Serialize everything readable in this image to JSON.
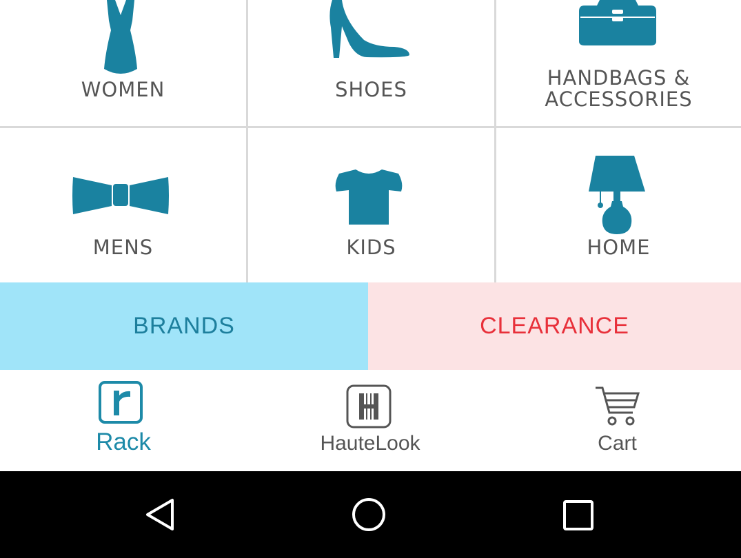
{
  "colors": {
    "teal": "#1a82a0",
    "category_text": "#555555",
    "brands_bg": "#a0e4f9",
    "brands_text": "#1d7f9d",
    "clearance_bg": "#fce3e4",
    "clearance_text": "#e8303a",
    "nav_active": "#1d8aa8",
    "nav_inactive": "#555555"
  },
  "categories": [
    {
      "label": "WOMEN",
      "icon": "dress-icon"
    },
    {
      "label": "SHOES",
      "icon": "high-heel-icon"
    },
    {
      "label_line1": "HANDBAGS &",
      "label_line2": "ACCESSORIES",
      "icon": "handbag-icon"
    },
    {
      "label": "MENS",
      "icon": "bowtie-icon"
    },
    {
      "label": "KIDS",
      "icon": "tshirt-icon"
    },
    {
      "label": "HOME",
      "icon": "lamp-icon"
    }
  ],
  "promos": {
    "brands_label": "BRANDS",
    "clearance_label": "CLEARANCE"
  },
  "bottom_nav": {
    "tabs": [
      {
        "label": "Rack",
        "icon": "rack-r-icon",
        "active": true
      },
      {
        "label": "HauteLook",
        "icon": "hautelook-h-icon",
        "active": false
      },
      {
        "label": "Cart",
        "icon": "cart-icon",
        "active": false
      }
    ]
  },
  "system_nav": {
    "buttons": [
      "back-icon",
      "home-circle-icon",
      "recents-square-icon"
    ]
  }
}
